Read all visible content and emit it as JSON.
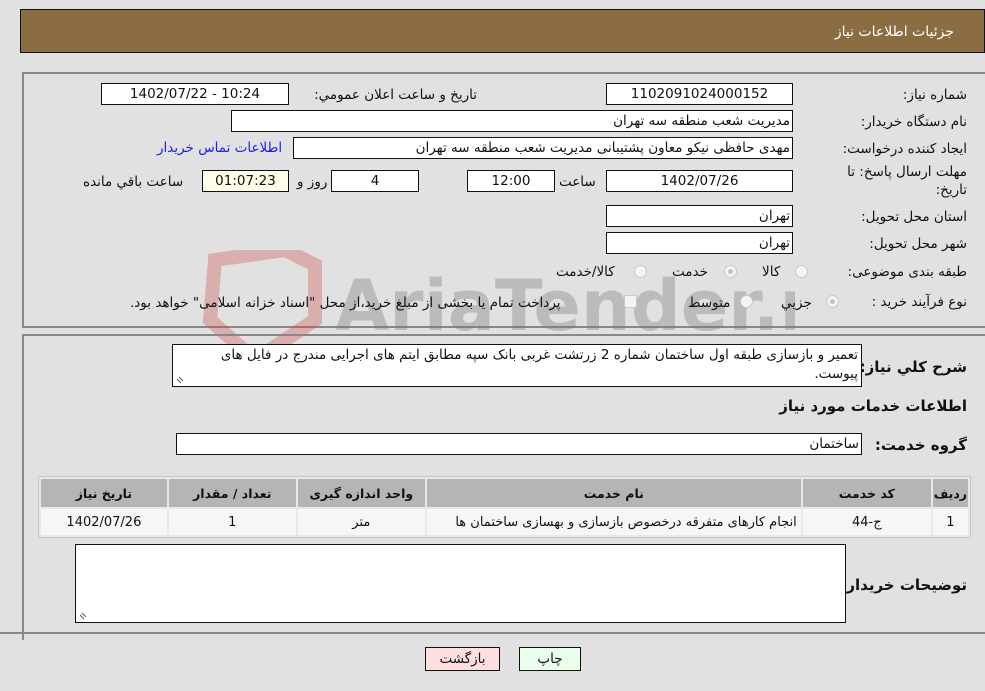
{
  "header": {
    "title": "جزئیات اطلاعات نیاز"
  },
  "form": {
    "need_number": {
      "label": "شماره نیاز:",
      "value": "1102091024000152"
    },
    "announce_datetime": {
      "label": "تاریخ و ساعت اعلان عمومي:",
      "value": "1402/07/22 - 10:24"
    },
    "buyer_org": {
      "label": "نام دستگاه خریدار:",
      "value": "مدیریت شعب منطقه سه تهران"
    },
    "requester": {
      "label": "ایجاد کننده درخواست:",
      "value": "مهدی حافظی نیکو معاون پشتیبانی مدیریت شعب منطقه سه تهران"
    },
    "buyer_contact_link": "اطلاعات تماس خریدار",
    "deadline": {
      "label_line1": "مهلت ارسال پاسخ: تا",
      "label_line2": "تاریخ:",
      "date": "1402/07/26",
      "time_label": "ساعت",
      "time": "12:00",
      "days": "4",
      "days_label": "روز و",
      "remaining": "01:07:23",
      "remaining_label": "ساعت باقي مانده"
    },
    "province": {
      "label": "استان محل تحویل:",
      "value": "تهران"
    },
    "city": {
      "label": "شهر محل تحویل:",
      "value": "تهران"
    },
    "category": {
      "label": "طبقه بندی موضوعی:",
      "options": [
        {
          "label": "کالا",
          "selected": false
        },
        {
          "label": "خدمت",
          "selected": true
        },
        {
          "label": "کالا/خدمت",
          "selected": false
        }
      ]
    },
    "purchase_type": {
      "label": "نوع فرآیند خرید :",
      "options": [
        {
          "label": "جزيي",
          "selected": true
        },
        {
          "label": "متوسط",
          "selected": false
        }
      ],
      "treasury_checkbox_label": "پرداخت تمام یا بخشی از مبلغ خرید،از محل \"اسناد خزانه اسلامی\" خواهد بود.",
      "treasury_checked": false
    }
  },
  "description": {
    "label": "شرح کلي نیاز:",
    "value": "تعمیر و بازسازی طبقه اول ساختمان شماره 2 زرتشت غربی بانک سپه مطابق ایتم های اجرایی مندرج در فایل های پیوست."
  },
  "services": {
    "section_title": "اطلاعات خدمات مورد نیاز",
    "group_label": "گروه خدمت:",
    "group_value": "ساختمان",
    "table": {
      "columns": [
        "ردیف",
        "کد خدمت",
        "نام خدمت",
        "واحد اندازه گیری",
        "تعداد / مقدار",
        "تاریخ نیاز"
      ],
      "rows": [
        [
          "1",
          "ج-44",
          "انجام کارهای متفرقه درخصوص بازسازی و بهسازی ساختمان ها",
          "متر",
          "1",
          "1402/07/26"
        ]
      ]
    }
  },
  "buyer_notes": {
    "label": "توضیحات خریدار:",
    "value": ""
  },
  "buttons": {
    "print": "چاپ",
    "back": "بازگشت"
  },
  "colors": {
    "header_bg": "#8b6d42",
    "print_bg": "#eaffea",
    "back_bg": "#ffdede",
    "link": "#1a1aff"
  }
}
